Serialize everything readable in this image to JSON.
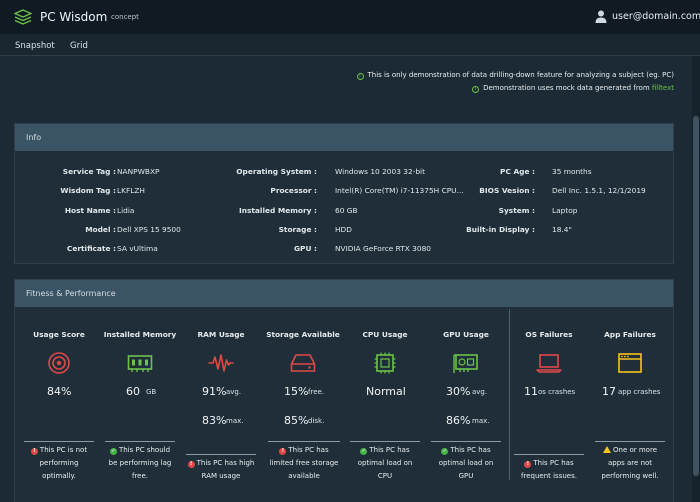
{
  "app": {
    "title": "PC Wisdom",
    "subtitle": "concept",
    "user_email": "user@domain.com"
  },
  "tabs": [
    "Snapshot",
    "Grid"
  ],
  "notices": [
    {
      "text": "This is only demonstration of data drilling-down feature for analyzing a subject (eg. PC)"
    },
    {
      "text": "Demonstration uses mock data generated from ",
      "link": "filltext"
    }
  ],
  "info": {
    "heading": "Info",
    "fields": [
      {
        "label": "Service Tag :",
        "value": "NANPWBXP"
      },
      {
        "label": "Wisdom Tag :",
        "value": "LKFLZH"
      },
      {
        "label": "Host Name :",
        "value": "Lidia"
      },
      {
        "label": "Model :",
        "value": "Dell XPS 15 9500"
      },
      {
        "label": "Certificate :",
        "value": "SA vUltima"
      },
      {
        "label": "Operating System :",
        "value": "Windows 10 2003 32-bit"
      },
      {
        "label": "Processor :",
        "value": "Intel(R) Core(TM) i7-11375H CPU..."
      },
      {
        "label": "Installed Memory :",
        "value": "60 GB"
      },
      {
        "label": "Storage :",
        "value": "HDD"
      },
      {
        "label": "GPU :",
        "value": "NVIDIA GeForce RTX 3080"
      },
      {
        "label": "PC Age :",
        "value": "35 months"
      },
      {
        "label": "BIOS Vesion :",
        "value": "Dell Inc. 1.5.1, 12/1/2019"
      },
      {
        "label": "System :",
        "value": "Laptop"
      },
      {
        "label": "Built-in Display :",
        "value": "18.4\""
      }
    ]
  },
  "fitness": {
    "heading": "Fitness & Performance",
    "metrics": [
      {
        "title": "Usage Score",
        "icon": "target-icon",
        "color": "#e04848",
        "value": "84%",
        "unit": "",
        "value2": "",
        "unit2": "",
        "status": "red",
        "status_text": [
          "This PC is not",
          "performing",
          "optimally."
        ]
      },
      {
        "title": "Installed Memory",
        "icon": "memory-icon",
        "color": "#6cc24a",
        "value": "60",
        "unit": "GB",
        "value2": "",
        "unit2": "",
        "status": "green",
        "status_text": [
          "This PC should",
          "be performing lag",
          "free."
        ]
      },
      {
        "title": "RAM Usage",
        "icon": "pulse-icon",
        "color": "#e04848",
        "value": "91%",
        "unit": "avg.",
        "value2": "83%",
        "unit2": "max.",
        "status": "red",
        "status_text": [
          "This PC has high",
          "RAM usage"
        ]
      },
      {
        "title": "Storage Available",
        "icon": "hdd-icon",
        "color": "#e04848",
        "value": "15%",
        "unit": "free.",
        "value2": "85%",
        "unit2": "disk.",
        "status": "red",
        "status_text": [
          "This PC has",
          "limited free storage",
          "available"
        ]
      },
      {
        "title": "CPU Usage",
        "icon": "cpu-icon",
        "color": "#6cc24a",
        "value": "Normal",
        "unit": "",
        "value2": "",
        "unit2": "",
        "status": "green",
        "status_text": [
          "This PC has",
          "optimal load on",
          "CPU"
        ]
      },
      {
        "title": "GPU Usage",
        "icon": "gpu-icon",
        "color": "#6cc24a",
        "value": "30%",
        "unit": "avg.",
        "value2": "86%",
        "unit2": "max.",
        "status": "green",
        "status_text": [
          "This PC has",
          "optimal load on",
          "GPU"
        ]
      },
      {
        "title": "OS Failures",
        "icon": "laptop-icon",
        "color": "#e04848",
        "value": "11",
        "unit": "os crashes",
        "value2": "",
        "unit2": "",
        "status": "red",
        "status_text": [
          "This PC has",
          "frequent issues."
        ]
      },
      {
        "title": "App Failures",
        "icon": "app-window-icon",
        "color": "#f5c518",
        "value": "17",
        "unit": "app crashes",
        "value2": "",
        "unit2": "",
        "status": "yellow",
        "status_text": [
          "One or more",
          "apps are not",
          "performing well."
        ]
      }
    ]
  }
}
